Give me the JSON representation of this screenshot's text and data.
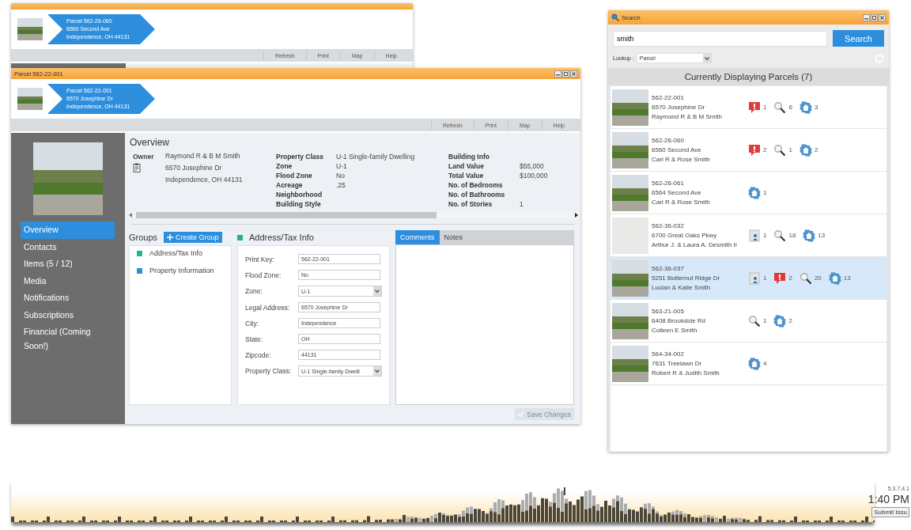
{
  "back_window": {
    "banner": {
      "lines": [
        "Parcel 562-26-060",
        "6560 Second Ave",
        "Independence, OH 44131"
      ]
    },
    "toolbar": [
      "Refresh",
      "Print",
      "Map",
      "Help"
    ]
  },
  "parcel_window": {
    "title": "Parcel 562-22-001",
    "banner": {
      "lines": [
        "Parcel 562-22-001",
        "6570 Josephine Dr",
        "Independence, OH 44131"
      ]
    },
    "toolbar": [
      "Refresh",
      "Print",
      "Map",
      "Help"
    ],
    "sidebar": {
      "items": [
        {
          "label": "Overview",
          "selected": true
        },
        {
          "label": "Contacts",
          "selected": false
        },
        {
          "label": "Items (5 / 12)",
          "selected": false
        },
        {
          "label": "Media",
          "selected": false
        },
        {
          "label": "Notifications",
          "selected": false
        },
        {
          "label": "Subscriptions",
          "selected": false
        },
        {
          "label": "Financial (Coming Soon!)",
          "selected": false
        }
      ]
    },
    "overview": {
      "title": "Overview",
      "owner": {
        "label": "Owner",
        "lines": [
          "Raymond R & B M Smith",
          "6570 Josephine Dr",
          "Independence, OH 44131"
        ]
      },
      "property_fields": [
        {
          "label": "Property Class",
          "value": "U-1 Single-family Dwelling"
        },
        {
          "label": "Zone",
          "value": "U-1"
        },
        {
          "label": "Flood Zone",
          "value": "No"
        },
        {
          "label": "Acreage",
          "value": ".25"
        },
        {
          "label": "Neighborhood"
        },
        {
          "label": "Building Style"
        }
      ],
      "building_fields": [
        {
          "label": "Building Info"
        },
        {
          "label": "Land Value",
          "value": "$55,000"
        },
        {
          "label": "Total Value",
          "value": "$100,000"
        },
        {
          "label": "No. of Bedrooms"
        },
        {
          "label": "No. of Bathrooms"
        },
        {
          "label": "No. of Stories",
          "value": "1"
        }
      ]
    },
    "groups": {
      "title": "Groups",
      "create_button": "Create Group",
      "items": [
        {
          "label": "Address/Tax Info",
          "color": "#22b58a"
        },
        {
          "label": "Property Information",
          "color": "#2e8ede"
        }
      ]
    },
    "form": {
      "title": "Address/Tax Info",
      "color": "#22b58a",
      "fields": [
        {
          "kind": "text",
          "label": "Print Key:",
          "value": "562-22-001"
        },
        {
          "kind": "text",
          "label": "Flood Zone:",
          "value": "No"
        },
        {
          "kind": "select",
          "label": "Zone:",
          "value": "U-1"
        },
        {
          "kind": "text",
          "label": "Legal Address:",
          "value": "6570 Josephine Dr"
        },
        {
          "kind": "text",
          "label": "City:",
          "value": "Independence"
        },
        {
          "kind": "text",
          "label": "State:",
          "value": "OH"
        },
        {
          "kind": "text",
          "label": "Zipcode:",
          "value": "44131"
        },
        {
          "kind": "select",
          "label": "Property Class:",
          "value": "U-1 Single-family Dwelli"
        }
      ]
    },
    "notes_tabs": [
      {
        "label": "Comments",
        "selected": true
      },
      {
        "label": "Notes",
        "selected": false
      }
    ],
    "save_button": {
      "label": "Save Changes",
      "disabled": true
    }
  },
  "search_window": {
    "title": "Search",
    "query": "smith",
    "search_button": "Search",
    "lookup": {
      "label": "Lookup :",
      "value": "Parcel"
    },
    "results_header": "Currently Displaying Parcels (7)",
    "results": [
      {
        "parcel": "562-22-001",
        "address": "6570 Josephine Dr",
        "owner": "Raymond R & B M Smith",
        "has_photo": true,
        "selected": false,
        "badges": [
          {
            "kind": "alert",
            "count": "1"
          },
          {
            "kind": "inspection",
            "count": "6"
          },
          {
            "kind": "house",
            "count": "3"
          }
        ]
      },
      {
        "parcel": "562-26-060",
        "address": "6560 Second Ave",
        "owner": "Carl R & Rose Smith",
        "has_photo": true,
        "selected": false,
        "badges": [
          {
            "kind": "alert",
            "count": "2"
          },
          {
            "kind": "inspection",
            "count": "1"
          },
          {
            "kind": "house",
            "count": "2"
          }
        ]
      },
      {
        "parcel": "562-26-061",
        "address": "6564 Second Ave",
        "owner": "Carl R & Rose Smith",
        "has_photo": true,
        "selected": false,
        "badges": [
          {
            "kind": "house",
            "count": "1"
          }
        ]
      },
      {
        "parcel": "562-36-032",
        "address": "6700 Great Oaks Pkwy",
        "owner": "Arthur J. & Laura A. Desmith II",
        "has_photo": false,
        "selected": false,
        "badges": [
          {
            "kind": "permit",
            "count": "1"
          },
          {
            "kind": "inspection",
            "count": "18"
          },
          {
            "kind": "house",
            "count": "13"
          }
        ]
      },
      {
        "parcel": "562-36-037",
        "address": "5251 Butternut Ridge Dr",
        "owner": "Lucian & Katie Smith",
        "has_photo": true,
        "selected": true,
        "badges": [
          {
            "kind": "permit",
            "count": "1"
          },
          {
            "kind": "alert",
            "count": "2"
          },
          {
            "kind": "inspection",
            "count": "20"
          },
          {
            "kind": "house",
            "count": "13"
          }
        ]
      },
      {
        "parcel": "563-21-005",
        "address": "6408 Brookside Rd",
        "owner": "Colleen E Smith",
        "has_photo": true,
        "selected": false,
        "badges": [
          {
            "kind": "inspection",
            "count": "1"
          },
          {
            "kind": "house",
            "count": "2"
          }
        ]
      },
      {
        "parcel": "564-34-002",
        "address": "7631 Treelawn Dr",
        "owner": "Robert R & Judith Smith",
        "has_photo": true,
        "selected": false,
        "badges": [
          {
            "kind": "house",
            "count": "4"
          }
        ]
      }
    ]
  },
  "footer": {
    "version": "5.3.7.4.1",
    "time": "1:40 PM",
    "submit_button": "Submit Issu"
  }
}
